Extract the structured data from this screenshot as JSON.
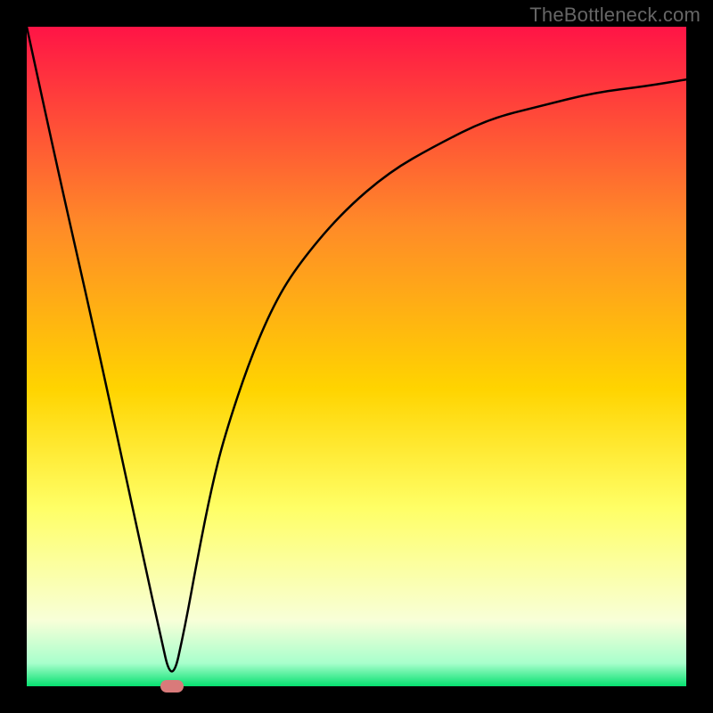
{
  "watermark": {
    "text": "TheBottleneck.com"
  },
  "colors": {
    "top": "#ff1446",
    "mid_upper": "#ff8a28",
    "mid": "#ffd400",
    "mid_lower": "#ffff66",
    "pale": "#f8ffd8",
    "green": "#06e070",
    "curve": "#000000",
    "marker": "#d97a7a",
    "frame": "#000000"
  },
  "chart_data": {
    "type": "line",
    "title": "",
    "xlabel": "",
    "ylabel": "",
    "xlim": [
      0,
      100
    ],
    "ylim": [
      0,
      100
    ],
    "grid": false,
    "legend": false,
    "annotations": [
      {
        "name": "optimal-marker",
        "x": 22,
        "y": 0
      }
    ],
    "series": [
      {
        "name": "bottleneck-curve",
        "x": [
          0,
          5,
          10,
          15,
          18,
          20,
          22,
          24,
          26,
          28,
          30,
          34,
          38,
          42,
          48,
          55,
          62,
          70,
          78,
          86,
          94,
          100
        ],
        "y": [
          100,
          77,
          55,
          32,
          18,
          9,
          0,
          9,
          20,
          30,
          38,
          50,
          59,
          65,
          72,
          78,
          82,
          86,
          88,
          90,
          91,
          92
        ]
      }
    ],
    "background_gradient_stops": [
      {
        "offset": 0.0,
        "color": "#ff1446"
      },
      {
        "offset": 0.3,
        "color": "#ff8a28"
      },
      {
        "offset": 0.55,
        "color": "#ffd400"
      },
      {
        "offset": 0.73,
        "color": "#ffff66"
      },
      {
        "offset": 0.9,
        "color": "#f8ffd8"
      },
      {
        "offset": 0.965,
        "color": "#a8ffcc"
      },
      {
        "offset": 1.0,
        "color": "#06e070"
      }
    ]
  }
}
